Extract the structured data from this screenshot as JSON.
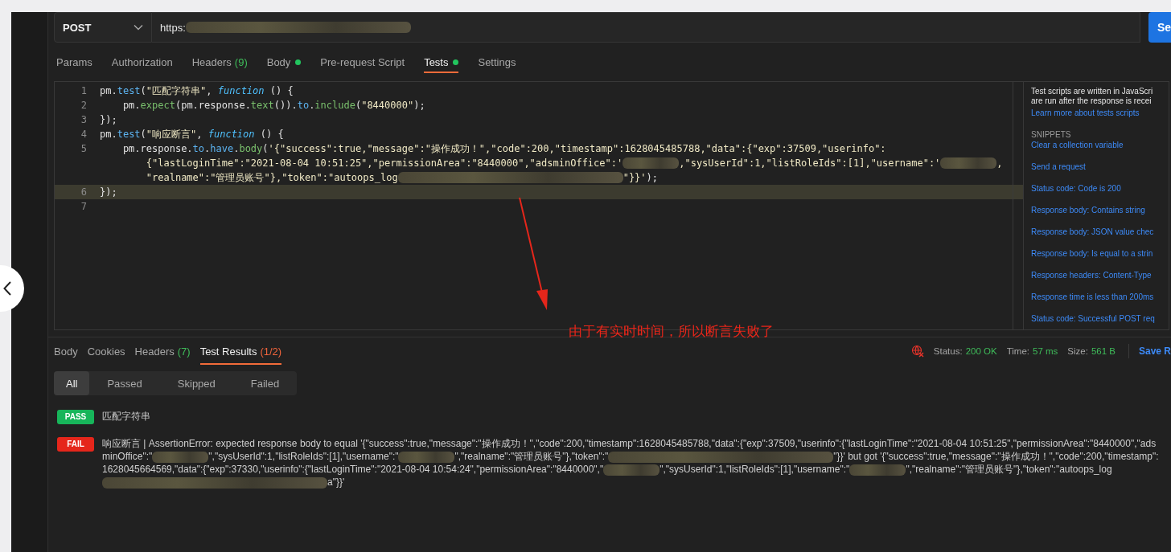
{
  "request": {
    "method": "POST",
    "url": [
      {
        "kind": "text",
        "text": "https:"
      },
      {
        "kind": "blur_long"
      }
    ],
    "send_button": "Se"
  },
  "request_tabs": [
    {
      "label": "Params",
      "selected": false,
      "dot": false
    },
    {
      "label": "Authorization",
      "selected": false,
      "dot": false
    },
    {
      "label": "Headers",
      "count": "(9)",
      "color": "#3fbc5a",
      "selected": false,
      "dot": false
    },
    {
      "label": "Body",
      "selected": false,
      "dot": true
    },
    {
      "label": "Pre-request Script",
      "selected": false,
      "dot": false
    },
    {
      "label": "Tests",
      "selected": true,
      "dot": true
    },
    {
      "label": "Settings",
      "selected": false,
      "dot": false
    }
  ],
  "editor": {
    "lines": [
      {
        "number": "1",
        "selected": false,
        "tokens": [
          {
            "kind": "plain",
            "text": "pm."
          },
          {
            "kind": "prop",
            "text": "test"
          },
          {
            "kind": "plain",
            "text": "("
          },
          {
            "kind": "str",
            "text": "\"匹配字符串\""
          },
          {
            "kind": "plain",
            "text": ", "
          },
          {
            "kind": "kw",
            "text": "function"
          },
          {
            "kind": "plain",
            "text": " () {"
          }
        ]
      },
      {
        "number": "2",
        "selected": false,
        "tokens": [
          {
            "kind": "plain",
            "text": "    pm."
          },
          {
            "kind": "call",
            "text": "expect"
          },
          {
            "kind": "plain",
            "text": "(pm.response."
          },
          {
            "kind": "call",
            "text": "text"
          },
          {
            "kind": "plain",
            "text": "())."
          },
          {
            "kind": "prop",
            "text": "to"
          },
          {
            "kind": "plain",
            "text": "."
          },
          {
            "kind": "call",
            "text": "include"
          },
          {
            "kind": "plain",
            "text": "("
          },
          {
            "kind": "str",
            "text": "\"8440000\""
          },
          {
            "kind": "plain",
            "text": ");"
          }
        ]
      },
      {
        "number": "3",
        "selected": false,
        "tokens": [
          {
            "kind": "plain",
            "text": "});"
          }
        ]
      },
      {
        "number": "4",
        "selected": false,
        "tokens": [
          {
            "kind": "plain",
            "text": "pm."
          },
          {
            "kind": "prop",
            "text": "test"
          },
          {
            "kind": "plain",
            "text": "("
          },
          {
            "kind": "str",
            "text": "\"响应断言\""
          },
          {
            "kind": "plain",
            "text": ", "
          },
          {
            "kind": "kw",
            "text": "function"
          },
          {
            "kind": "plain",
            "text": " () {"
          }
        ]
      },
      {
        "number": "5",
        "selected": false,
        "tokens": [
          {
            "kind": "plain",
            "text": "    pm.response."
          },
          {
            "kind": "prop",
            "text": "to"
          },
          {
            "kind": "plain",
            "text": "."
          },
          {
            "kind": "prop",
            "text": "have"
          },
          {
            "kind": "plain",
            "text": "."
          },
          {
            "kind": "call",
            "text": "body"
          },
          {
            "kind": "plain",
            "text": "("
          },
          {
            "kind": "str",
            "text": "'{\"success\":true,\"message\":\"操作成功！\",\"code\":200,\"timestamp\":1628045485788,\"data\":{\"exp\":37509,\"userinfo\":"
          }
        ]
      },
      {
        "selected": false,
        "tokens": [
          {
            "kind": "str",
            "text": "        {\"lastLoginTime\":\"2021-08-04 10:51:25\",\"permissionArea\":\"8440000\",\"adsminOffice\":'"
          },
          {
            "kind": "blur"
          },
          {
            "kind": "str",
            "text": ",\"sysUserId\":1,\"listRoleIds\":[1],\"username\":'"
          },
          {
            "kind": "blur"
          },
          {
            "kind": "str",
            "text": ","
          }
        ]
      },
      {
        "selected": false,
        "tokens": [
          {
            "kind": "str",
            "text": "        \"realname\":\"管理员账号\"},\"token\":\"autoops_log"
          },
          {
            "kind": "blur_long"
          },
          {
            "kind": "str",
            "text": "\"}}'"
          },
          {
            "kind": "plain",
            "text": ");"
          }
        ]
      },
      {
        "number": "6",
        "selected": true,
        "tokens": [
          {
            "kind": "plain",
            "text": "});"
          }
        ]
      },
      {
        "number": "7",
        "selected": false
      }
    ]
  },
  "help_panel": {
    "intro_lines": [
      "Test scripts are written in JavaScri",
      "are run after the response is recei"
    ],
    "link": "Learn more about tests scripts",
    "heading": "SNIPPETS",
    "snippets": [
      "Clear a collection variable",
      "Send a request",
      "Status code: Code is 200",
      "Response body: Contains string",
      "Response body: JSON value chec",
      "Response body: Is equal to a strin",
      "Response headers: Content-Type",
      "Response time is less than 200ms",
      "Status code: Successful POST req"
    ]
  },
  "response_tabs": [
    {
      "label": "Body",
      "selected": false
    },
    {
      "label": "Cookies",
      "selected": false
    },
    {
      "label": "Headers",
      "count": "(7)",
      "color": "#3fbc5a",
      "selected": false
    },
    {
      "label": "Test Results",
      "count": "(1/2)",
      "color": "#f0643c",
      "selected": true
    }
  ],
  "response_meta": {
    "status_label": "Status:",
    "status": "200 OK",
    "time_label": "Time:",
    "time": "57 ms",
    "size_label": "Size:",
    "size": "561 B",
    "save": "Save R"
  },
  "filters": [
    {
      "label": "All",
      "selected": true
    },
    {
      "label": "Passed",
      "selected": false
    },
    {
      "label": "Skipped",
      "selected": false
    },
    {
      "label": "Failed",
      "selected": false
    }
  ],
  "results": [
    {
      "status": "PASS",
      "segments": [
        {
          "kind": "text",
          "text": "匹配字符串"
        }
      ]
    },
    {
      "status": "FAIL",
      "segments": [
        {
          "kind": "text",
          "text": "响应断言 | AssertionError: expected response body to equal '{\"success\":true,\"message\":\"操作成功！\",\"code\":200,\"timestamp\":1628045485788,\"data\":{\"exp\":37509,\"userinfo\":{\"lastLoginTime\":\"2021-08-04 10:51:25\",\"permissionArea\":\"8440000\",\"adsminOffice\":\""
        },
        {
          "kind": "blur"
        },
        {
          "kind": "text",
          "text": "\",\"sysUserId\":1,\"listRoleIds\":[1],\"username\":\""
        },
        {
          "kind": "blur"
        },
        {
          "kind": "text",
          "text": "\",\"realname\":\"管理员账号\"},\"token\":\""
        },
        {
          "kind": "blur_long"
        },
        {
          "kind": "text",
          "text": "\"}}' but got '{\"success\":true,\"message\":\"操作成功！\",\"code\":200,\"timestamp\":1628045664569,\"data\":{\"exp\":37330,\"userinfo\":{\"lastLoginTime\":\"2021-08-04 10:54:24\",\"permissionArea\":\"8440000\",\""
        },
        {
          "kind": "blur"
        },
        {
          "kind": "text",
          "text": "\",\"sysUserId\":1,\"listRoleIds\":[1],\"username\":\""
        },
        {
          "kind": "blur"
        },
        {
          "kind": "text",
          "text": "\",\"realname\":\"管理员账号\"},\"token\":\"autoops_log"
        },
        {
          "kind": "blur_long"
        },
        {
          "kind": "text",
          "text": "a\"}}'"
        }
      ]
    }
  ],
  "annotation": {
    "text": "由于有实时时间，所以断言失败了"
  }
}
